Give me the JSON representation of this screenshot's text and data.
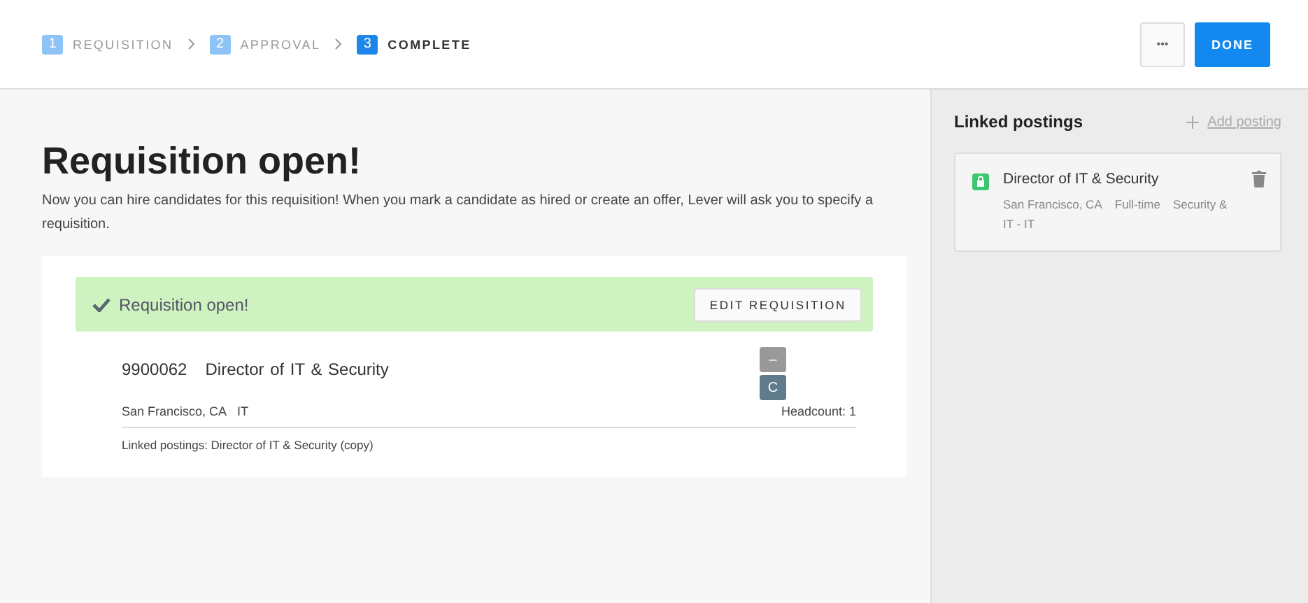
{
  "steps": [
    {
      "number": "1",
      "label": "REQUISITION",
      "selected": false
    },
    {
      "number": "2",
      "label": "APPROVAL",
      "selected": false
    },
    {
      "number": "3",
      "label": "COMPLETE",
      "selected": true
    }
  ],
  "header_actions": {
    "more": "•••",
    "done": "DONE"
  },
  "main": {
    "title": "Requisition open!",
    "description": "Now you can hire candidates for this requisition! When you mark a candidate as hired or create an offer, Lever will ask you to specify a requisition.",
    "banner": {
      "text": "Requisition open!",
      "button": "EDIT REQUISITION"
    },
    "requisition": {
      "code": "9900062",
      "title": "Director of IT & Security",
      "badges": [
        {
          "text": "–",
          "kind": "minus"
        },
        {
          "text": "C",
          "kind": "letter"
        }
      ],
      "location": "San Francisco, CA",
      "department": "IT",
      "headcount": "Headcount: 1",
      "linked": "Linked postings: Director of IT & Security (copy)"
    }
  },
  "sidebar": {
    "title": "Linked postings",
    "add": "Add posting",
    "postings": [
      {
        "title": "Director of IT & Security",
        "meta": [
          "San Francisco, CA",
          "Full-time",
          "Security & IT - IT"
        ]
      }
    ]
  }
}
